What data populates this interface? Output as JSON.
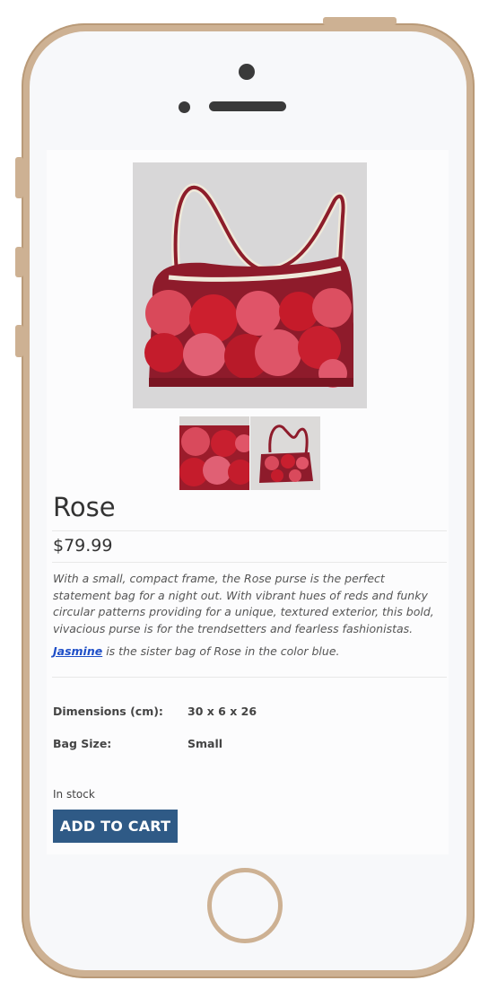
{
  "product": {
    "title": "Rose",
    "price": "$79.99",
    "description": "With a small, compact frame, the Rose purse is the perfect statement bag for a night out. With vibrant hues of reds and funky circular patterns providing for a unique, textured exterior, this bold, vivacious purse is for the trendsetters and fearless fashionistas.",
    "sister_link": "Jasmine",
    "sister_text": " is the sister bag of Rose in the color blue.",
    "specs": [
      {
        "label": "Dimensions (cm):",
        "value": "30 x 6 x 26"
      },
      {
        "label": "Bag Size:",
        "value": "Small"
      }
    ],
    "stock": "In stock",
    "cart_label": "ADD TO CART"
  },
  "colors": {
    "frame": "#cdb193",
    "button": "#2f5a86",
    "link": "#1f4fc8",
    "bag_red": "#b8202e"
  }
}
